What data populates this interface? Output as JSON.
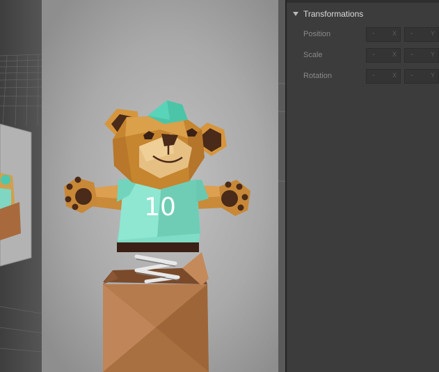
{
  "inspector": {
    "section_title": "Transformations",
    "properties": [
      {
        "label": "Position",
        "fields": [
          {
            "value": "-",
            "axis": "X"
          },
          {
            "value": "-",
            "axis": "Y"
          }
        ]
      },
      {
        "label": "Scale",
        "fields": [
          {
            "value": "-",
            "axis": "X"
          },
          {
            "value": "-",
            "axis": "Y"
          }
        ]
      },
      {
        "label": "Rotation",
        "fields": [
          {
            "value": "-",
            "axis": "X"
          },
          {
            "value": "-",
            "axis": "Y"
          }
        ]
      }
    ]
  },
  "viewport": {
    "shirt_number": "10"
  }
}
